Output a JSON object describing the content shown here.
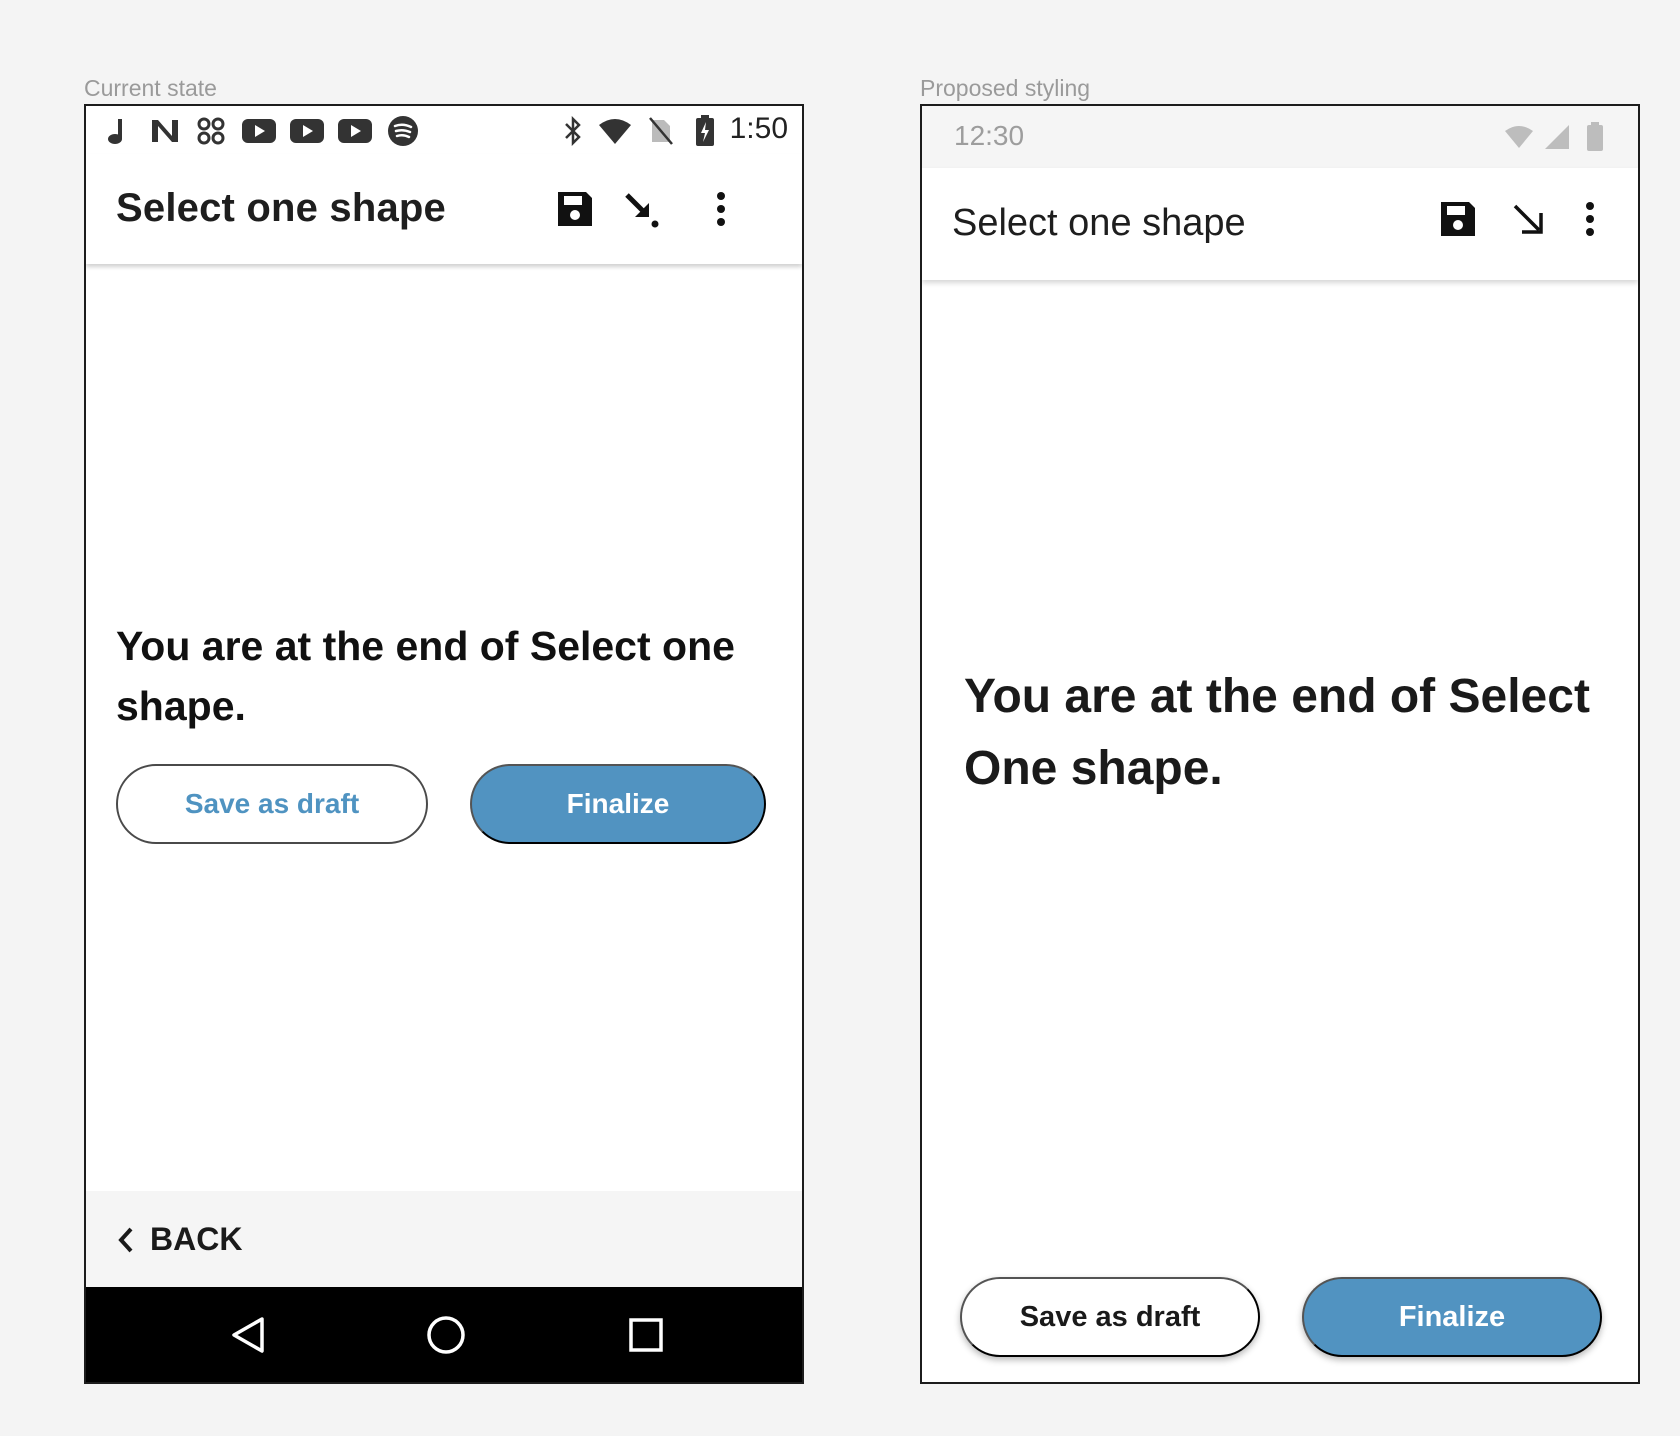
{
  "left_caption": "Current state",
  "right_caption": "Proposed styling",
  "current": {
    "status": {
      "time": "1:50",
      "notification_icons": [
        "music-note-icon",
        "n-logo-icon",
        "puzzle-icon",
        "youtube-icon",
        "youtube-icon",
        "youtube-icon",
        "spotify-icon"
      ],
      "system_icons": [
        "bluetooth-icon",
        "wifi-icon",
        "no-sim-icon",
        "battery-charging-icon"
      ]
    },
    "app_bar": {
      "title": "Select one shape"
    },
    "message": "You are at the end of Select one shape.",
    "save_draft_label": "Save as draft",
    "finalize_label": "Finalize",
    "back_label": "BACK"
  },
  "proposed": {
    "status": {
      "time": "12:30"
    },
    "app_bar": {
      "title": "Select one shape"
    },
    "message": "You are at the end of Select One shape.",
    "save_draft_label": "Save as draft",
    "finalize_label": "Finalize"
  },
  "colors": {
    "accent_blue": "#5193c1",
    "page_background": "#f4f4f4",
    "nav_bar": "#000000"
  }
}
